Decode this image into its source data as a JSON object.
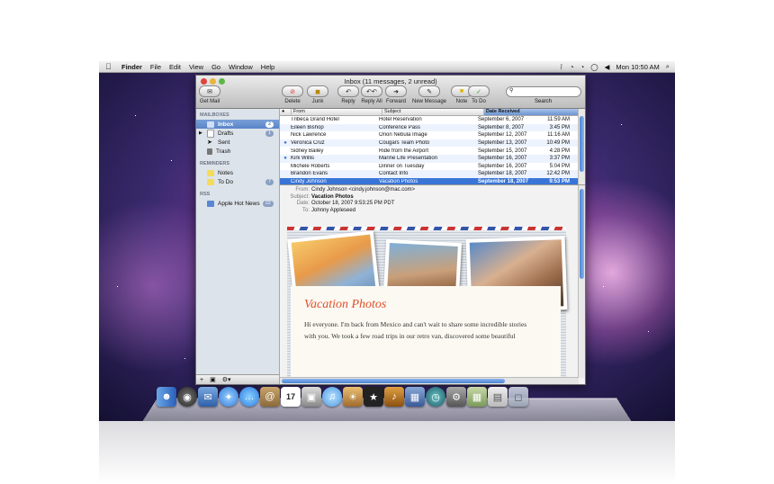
{
  "menubar": {
    "app": "Finder",
    "items": [
      "File",
      "Edit",
      "View",
      "Go",
      "Window",
      "Help"
    ],
    "clock": "Mon 10:50 AM"
  },
  "window": {
    "title": "Inbox (11 messages, 2 unread)",
    "get_mail": "Get Mail",
    "toolbar": [
      "Delete",
      "Junk",
      "Reply",
      "Reply All",
      "Forward",
      "New Message",
      "Note",
      "To Do"
    ],
    "search_label": "Search"
  },
  "sidebar": {
    "mailboxes_header": "MAILBOXES",
    "mailboxes": [
      {
        "label": "Inbox",
        "badge": "2"
      },
      {
        "label": "Drafts",
        "badge": "1"
      },
      {
        "label": "Sent",
        "badge": ""
      },
      {
        "label": "Trash",
        "badge": ""
      }
    ],
    "reminders_header": "REMINDERS",
    "reminders": [
      {
        "label": "Notes",
        "badge": ""
      },
      {
        "label": "To Do",
        "badge": "7"
      }
    ],
    "rss_header": "RSS",
    "rss": [
      {
        "label": "Apple Hot News",
        "badge": "22"
      }
    ]
  },
  "list": {
    "headers": {
      "from": "From",
      "subject": "Subject",
      "date": "Date Received"
    },
    "rows": [
      {
        "from": "Tribeca Grand Hotel",
        "subject": "Hotel Reservation",
        "date": "September 6, 2007",
        "time": "11:59 AM",
        "unread": false
      },
      {
        "from": "Eileen Bishop",
        "subject": "Conference Pass",
        "date": "September 8, 2007",
        "time": "3:45 PM",
        "unread": false
      },
      {
        "from": "Nick Lawrence",
        "subject": "Orion Nebula Image",
        "date": "September 12, 2007",
        "time": "11:16 AM",
        "unread": false
      },
      {
        "from": "Veronica Cruz",
        "subject": "Cougars Team Photo",
        "date": "September 13, 2007",
        "time": "10:49 PM",
        "unread": true
      },
      {
        "from": "Sidney Bailey",
        "subject": "Ride from the Airport",
        "date": "September 15, 2007",
        "time": "4:28 PM",
        "unread": false
      },
      {
        "from": "Kirk Willis",
        "subject": "Marine Life Presentation",
        "date": "September 16, 2007",
        "time": "3:37 PM",
        "unread": true
      },
      {
        "from": "Michele Roberts",
        "subject": "Dinner on Tuesday",
        "date": "September 16, 2007",
        "time": "5:04 PM",
        "unread": false
      },
      {
        "from": "Brandon Evans",
        "subject": "Contact Info",
        "date": "September 18, 2007",
        "time": "12:42 PM",
        "unread": false
      },
      {
        "from": "Cindy Johnson",
        "subject": "Vacation Photos",
        "date": "September 18, 2007",
        "time": "9:53 PM",
        "unread": false,
        "selected": true
      }
    ]
  },
  "message": {
    "labels": {
      "from": "From:",
      "subject": "Subject:",
      "date": "Date:",
      "to": "To:"
    },
    "from": "Cindy Johnson <cindy.johnson@mac.com>",
    "subject": "Vacation Photos",
    "date": "October 18, 2007 9:53:25 PM PDT",
    "to": "Johnny Appleseed",
    "body_title": "Vacation Photos",
    "body_line1": "Hi everyone. I'm back from Mexico and can't wait to share some incredible stories",
    "body_line2": "with you. We took a few road trips in our retro van, discovered some beautiful"
  },
  "dock": {
    "calendar_day": "17"
  },
  "colors": {
    "selection": "#3875d7",
    "body_title": "#e0502a",
    "desktop": "#3a2a6e"
  }
}
